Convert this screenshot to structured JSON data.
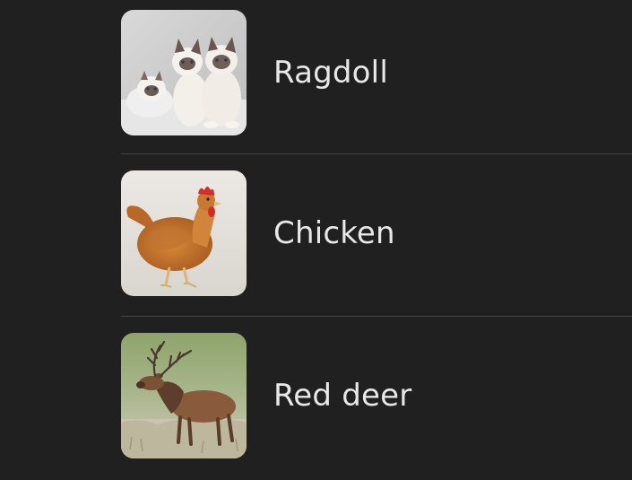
{
  "results": [
    {
      "label": "Ragdoll",
      "icon": "ragdoll-cat-thumbnail"
    },
    {
      "label": "Chicken",
      "icon": "chicken-thumbnail"
    },
    {
      "label": "Red deer",
      "icon": "red-deer-thumbnail"
    }
  ],
  "colors": {
    "background": "#202020",
    "text": "#e8e8e8",
    "divider": "#444444"
  }
}
